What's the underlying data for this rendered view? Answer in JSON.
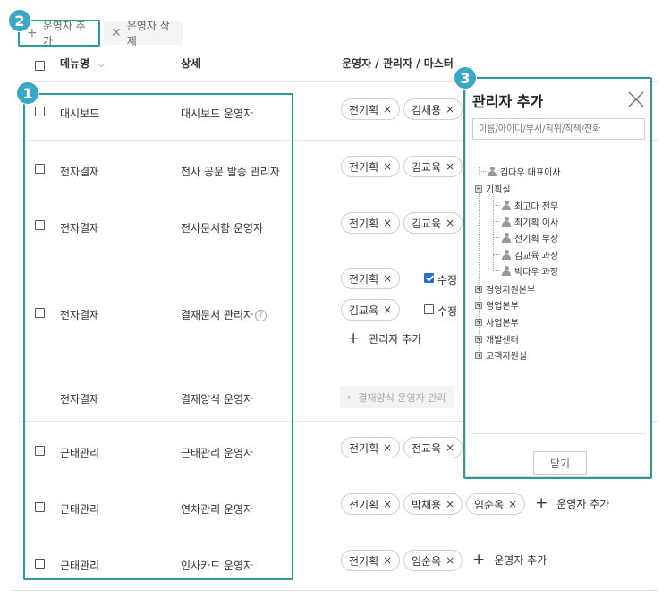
{
  "toolbar": {
    "add_label": "운영자 추가",
    "delete_label": "운영자 삭제"
  },
  "badges": [
    "2",
    "1",
    "3"
  ],
  "header": {
    "menu": "메뉴명",
    "detail": "상세",
    "operators": "운영자 / 관리자 / 마스터"
  },
  "rows": [
    {
      "menu": "대시보드",
      "detail": "대시보드 운영자",
      "chips": [
        "전기획",
        "김채용"
      ]
    },
    {
      "menu": "전자결재",
      "detail": "전사 공문 발송 관리자",
      "chips": [
        "전기획",
        "김교육"
      ]
    },
    {
      "menu": "전자결재",
      "detail": "전사문서함 운영자",
      "chips": [
        "전기획",
        "김교육"
      ]
    },
    {
      "menu": "전자결재",
      "detail": "결재문서 관리자",
      "chips": [
        "전기획",
        "김교육"
      ],
      "perm_checked": "수정",
      "perm_unchecked": "수정",
      "add_admin": "관리자 추가"
    },
    {
      "menu": "전자결재",
      "detail": "결재양식 운영자",
      "button": "결재양식 운영자 관리"
    },
    {
      "menu": "근태관리",
      "detail": "근태관리 운영자",
      "chips": [
        "전기획",
        "전교육"
      ]
    },
    {
      "menu": "근태관리",
      "detail": "연차관리 운영자",
      "chips": [
        "전기획",
        "박채용",
        "임순옥"
      ],
      "add_op": "운영자 추가"
    },
    {
      "menu": "근태관리",
      "detail": "인사카드 운영자",
      "chips": [
        "전기획",
        "임순옥"
      ],
      "add_op": "운영자 추가"
    }
  ],
  "chip_close": "×",
  "help_mark": "?",
  "modal": {
    "title": "관리자 추가",
    "search_placeholder": "이름/아이디/부서/직위/직책/전화",
    "tree": {
      "top_person": "김다우 대표이사",
      "dept_open": "기획실",
      "members": [
        "최고다 전무",
        "최기획 이사",
        "전기획 부장",
        "김교육 과장",
        "박다우 과장"
      ],
      "depts_closed": [
        "경영지원본부",
        "영업본부",
        "사업본부",
        "개발센터",
        "고객지원실"
      ]
    },
    "close_button": "닫기"
  },
  "colors": {
    "highlight": "#2a9a9a",
    "badge": "#3aa7c4",
    "checkbox_checked": "#1f6fd1"
  }
}
